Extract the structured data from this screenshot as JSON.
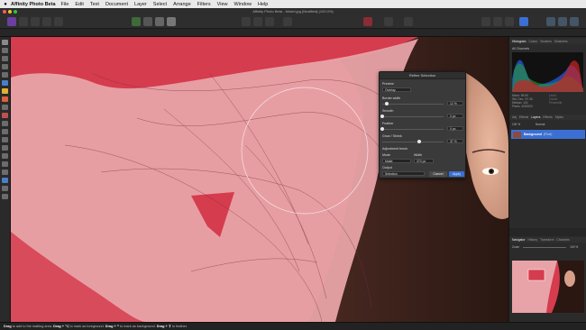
{
  "menubar": {
    "app_name": "Affinity Photo Beta",
    "items": [
      "File",
      "Edit",
      "Text",
      "Document",
      "Layer",
      "Select",
      "Arrange",
      "Filters",
      "View",
      "Window",
      "Help"
    ]
  },
  "window": {
    "title": "Affinity Photo Beta - Model.jpg [Modified] (100.0%)"
  },
  "refine_dialog": {
    "title": "Refine Selection",
    "preview_label": "Preview",
    "preview_value": "Overlay",
    "border_width_label": "Border width",
    "border_width_value": "12 %",
    "border_width_level": 0.08,
    "smooth_label": "Smooth",
    "smooth_value": "0 px",
    "smooth_level": 0.0,
    "feather_label": "Feather",
    "feather_value": "0 px",
    "feather_level": 0.0,
    "grow_shrink_label": "Grow / Shrink",
    "grow_shrink_value": "37 %",
    "grow_shrink_level": 0.6,
    "adjustment_brush_label": "Adjustment brush",
    "mode_label": "Mode",
    "mode_value": "Matte",
    "width_label": "Width",
    "width_value": "370 px",
    "output_label": "Output",
    "output_value": "Selection",
    "cancel_label": "Cancel",
    "apply_label": "Apply"
  },
  "right_panel": {
    "histogram_tabs": [
      "Histogram",
      "Colour",
      "Brushes",
      "Swatches"
    ],
    "channel_label": "All Channels",
    "stats": [
      "Mean: 96.69",
      "Std. Dev.: 67.36",
      "Median: 104",
      "Pixels: 4000000"
    ],
    "stat_labels_right": [
      "Level:",
      "Count:",
      "Percentile:"
    ],
    "layer_tabs": [
      "Adj",
      "Effects",
      "Layers",
      "Effects",
      "Styles"
    ],
    "blend_opacity": "100 %",
    "blend_mode": "Normal",
    "layer_name": "Background",
    "layer_kind": "(Pixel)",
    "nav_tabs": [
      "Navigator",
      "History",
      "Transform",
      "Channels"
    ],
    "zoom_label": "Zoom",
    "zoom_value": "100 %"
  },
  "statusbar": {
    "drag_1": "Drag",
    "text_1": " to add to the matting area. ",
    "drag_2": "Drag + ⌥",
    "text_2": " to mark as foreground. ",
    "drag_3": "Drag + ^",
    "text_3": " to mark as background. ",
    "drag_4": "Drag + ⇧",
    "text_4": " to feather."
  },
  "colors": {
    "overlay_red": "#d53c4e",
    "overlay_pink": "#e8a3a8",
    "accent_blue": "#3b6fd4"
  }
}
